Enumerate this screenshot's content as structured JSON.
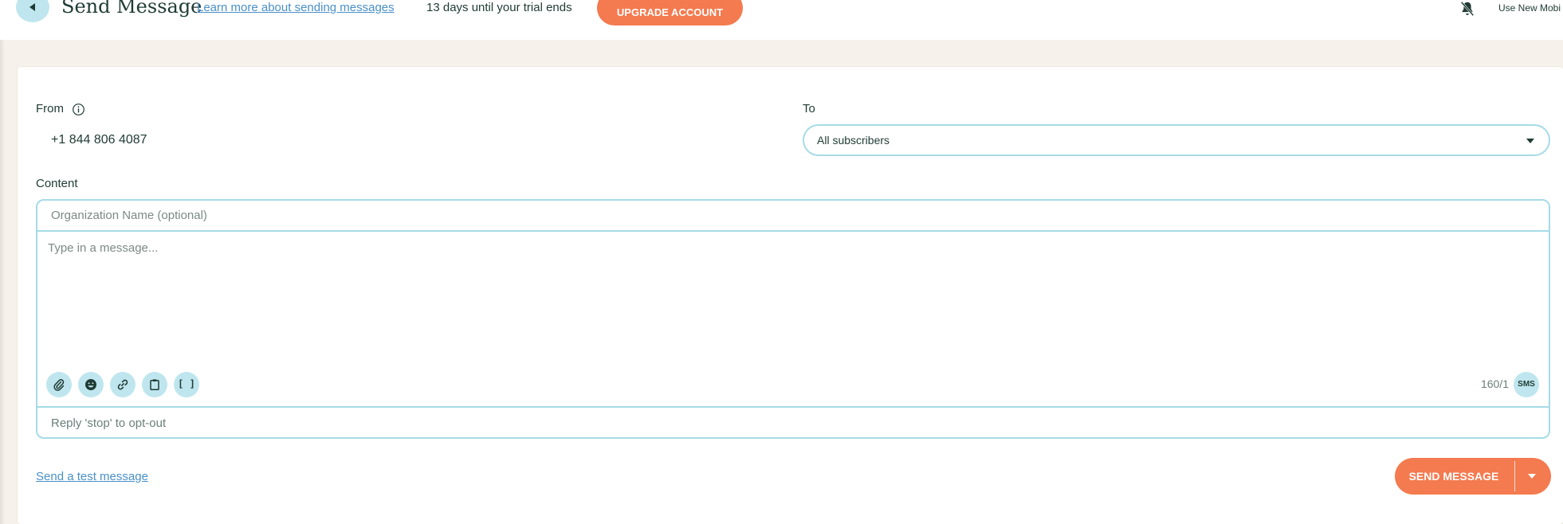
{
  "header": {
    "title": "Send Message",
    "learn_link": "Learn more about sending messages",
    "trial_text": "13 days until your trial ends",
    "upgrade_label": "UPGRADE ACCOUNT",
    "use_new_text": "Use New Mobi"
  },
  "form": {
    "from_label": "From",
    "from_value": "+1 844 806 4087",
    "to_label": "To",
    "to_selected": "All subscribers",
    "content_label": "Content",
    "org_placeholder": "Organization Name (optional)",
    "message_placeholder": "Type in a message...",
    "char_count": "160/1",
    "sms_badge": "SMS",
    "optout_text": "Reply 'stop' to opt-out",
    "toolbar_icons": [
      "paperclip-icon",
      "emoji-icon",
      "link-icon",
      "clipboard-icon",
      "brackets-icon"
    ],
    "bracket_glyph": "[ ]"
  },
  "footer": {
    "test_link": "Send a test message",
    "send_label": "SEND MESSAGE"
  },
  "colors": {
    "accent": "#f47a4f",
    "tint": "#bfe6ee",
    "border": "#a6dbe6",
    "link": "#4a90c8",
    "text": "#1f3b34"
  }
}
